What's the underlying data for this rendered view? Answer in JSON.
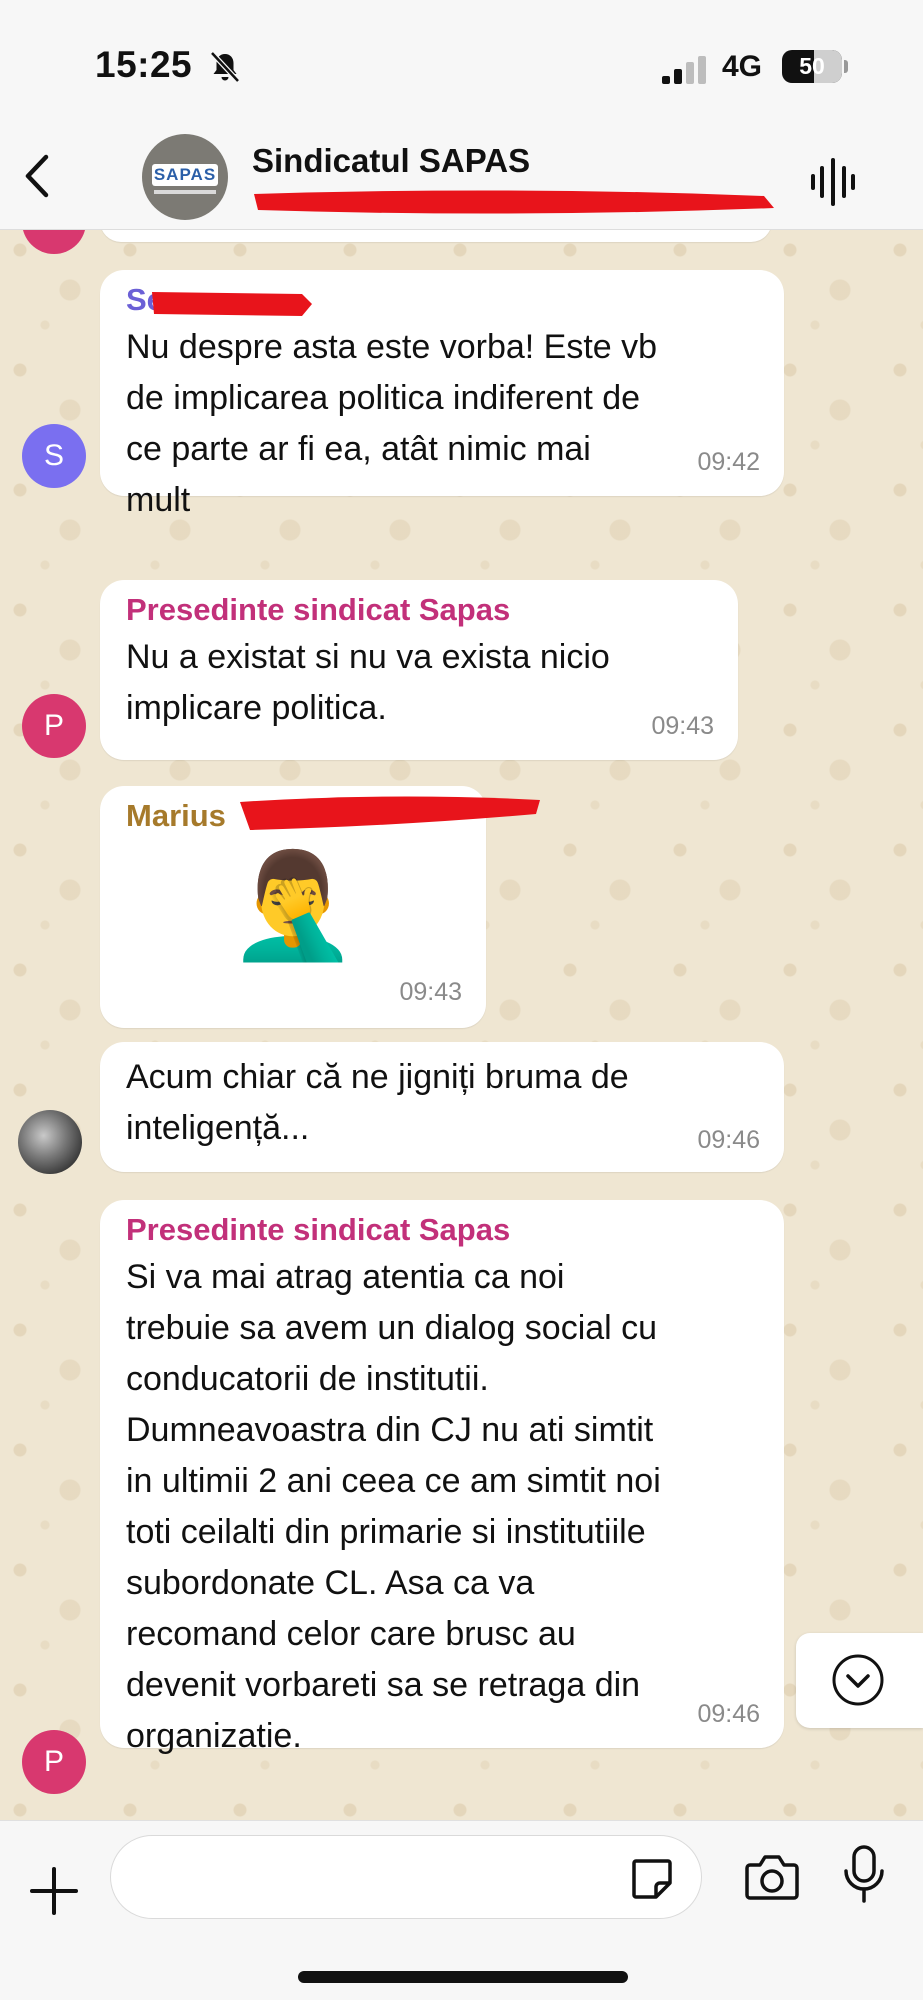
{
  "status_bar": {
    "time": "15:25",
    "network": "4G",
    "battery": "50"
  },
  "header": {
    "title": "Sindicatul SAPAS",
    "avatar_text": "SAPAS"
  },
  "messages": [
    {
      "sender": "Se",
      "sender_color": "#6b60d6",
      "avatar_letter": "S",
      "avatar_color": "#7a6ff0",
      "text": "Nu despre asta este vorba! Este vb\nde implicarea politica indiferent de\nce parte ar fi ea, atât nimic mai\nmult",
      "time": "09:42"
    },
    {
      "sender": "Presedinte sindicat Sapas",
      "sender_color": "#c2307a",
      "avatar_letter": "P",
      "avatar_color": "#d8386f",
      "text": "Nu a existat si nu va exista nicio\nimplicare politica.",
      "time": "09:43"
    },
    {
      "sender": "Marius",
      "sender_color": "#a67a2b",
      "emoji": "🤦‍♂️",
      "time": "09:43"
    },
    {
      "text": "Acum chiar că ne jigniți bruma de\ninteligență...",
      "time": "09:46"
    },
    {
      "sender": "Presedinte sindicat Sapas",
      "sender_color": "#c2307a",
      "avatar_letter": "P",
      "avatar_color": "#d8386f",
      "text": "Si va mai atrag atentia ca noi\ntrebuie sa avem un dialog social cu\nconducatorii de institutii.\nDumneavoastra din CJ nu ati simtit\nin ultimii 2 ani ceea ce am simtit noi\ntoti ceilalti din primarie si institutiile\nsubordonate CL. Asa ca va\nrecomand celor care brusc au\ndevenit vorbareti sa se retraga din\norganizatie.",
      "time": "09:46"
    }
  ],
  "input": {
    "placeholder": ""
  }
}
